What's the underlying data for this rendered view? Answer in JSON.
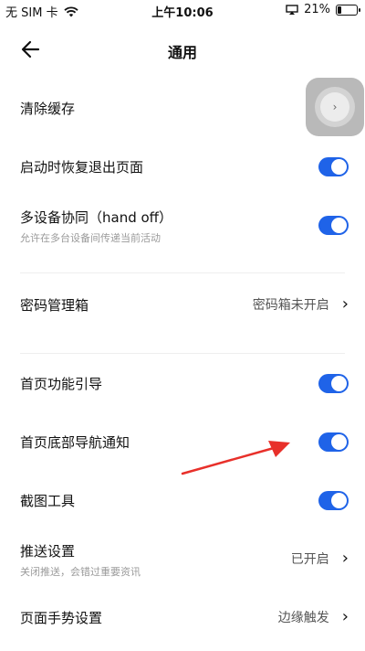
{
  "status_bar": {
    "carrier": "无 SIM 卡",
    "wifi_icon": "wifi-icon",
    "time": "上午10:06",
    "airplay_icon": "screen-mirror-icon",
    "battery_percent": "21%",
    "battery_level": 0.21
  },
  "nav": {
    "back_icon": "back-arrow-icon",
    "title": "通用"
  },
  "settings": {
    "clear_cache": {
      "label": "清除缓存"
    },
    "restore_pages": {
      "label": "启动时恢复退出页面",
      "on": true
    },
    "handoff": {
      "label": "多设备协同（hand off）",
      "sub": "允许在多台设备间传递当前活动",
      "on": true
    },
    "password_box": {
      "label": "密码管理箱",
      "value": "密码箱未开启"
    },
    "home_guide": {
      "label": "首页功能引导",
      "on": true
    },
    "home_nav_notice": {
      "label": "首页底部导航通知",
      "on": true
    },
    "screenshot_tool": {
      "label": "截图工具",
      "on": true
    },
    "push": {
      "label": "推送设置",
      "sub": "关闭推送，会错过重要资讯",
      "value": "已开启"
    },
    "gesture": {
      "label": "页面手势设置",
      "value": "边缘触发"
    }
  },
  "colors": {
    "toggle_on": "#1f63e8",
    "annotation_arrow": "#e8302a"
  }
}
